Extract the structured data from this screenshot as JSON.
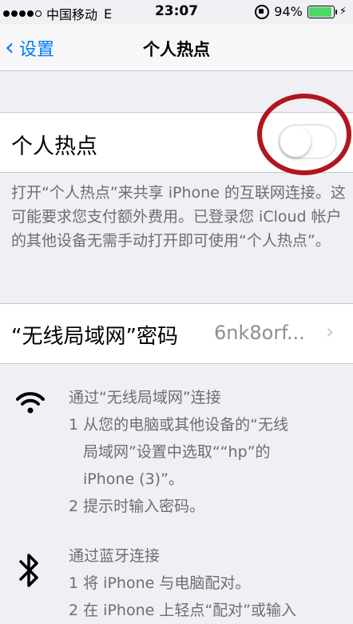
{
  "status": {
    "carrier": "中国移动",
    "network": "E",
    "time": "23:07",
    "battery_percent": "94%",
    "battery_level": 0.94
  },
  "nav": {
    "back_label": "设置",
    "title": "个人热点"
  },
  "hotspot": {
    "label": "个人热点",
    "enabled": false,
    "description": "打开“个人热点”来共享 iPhone 的互联网连接。这可能要求您支付额外费用。已登录您 iCloud 帐户的其他设备无需手动打开即可使用“个人热点”。"
  },
  "wifi_password": {
    "label": "“无线局域网”密码",
    "value": "6nk8orf..."
  },
  "instructions": {
    "wifi": {
      "title": "通过“无线局域网”连接",
      "step1_a": "1 从您的电脑或其他设备的“无线",
      "step1_b": "局域网”设置中选取““hp”的",
      "step1_c": "iPhone (3)”。",
      "step2": "2 提示时输入密码。"
    },
    "bluetooth": {
      "title": "通过蓝牙连接",
      "step1": "1 将 iPhone 与电脑配对。",
      "step2": "2 在 iPhone 上轻点“配对”或输入"
    }
  }
}
